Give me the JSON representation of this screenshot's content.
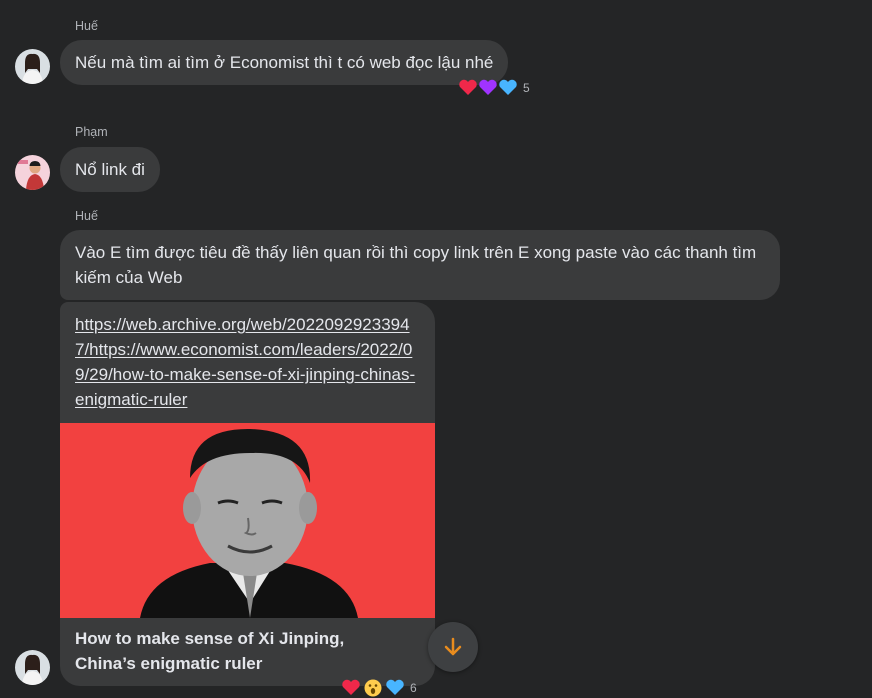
{
  "messages": [
    {
      "sender": "Huế",
      "text": "Nếu mà tìm ai tìm ở Economist thì t có web đọc lậu nhé",
      "reaction_count": "5"
    },
    {
      "sender": "Phạm",
      "text": "Nổ link đi"
    },
    {
      "sender": "Huế",
      "text": "Vào E tìm được tiêu đề thấy liên quan rồi thì copy link trên E xong paste vào các thanh tìm kiếm của Web"
    }
  ],
  "link_card": {
    "url": "https://web.archive.org/web/20220929233947/https://www.economist.com/leaders/2022/09/29/how-to-make-sense-of-xi-jinping-chinas-enigmatic-ruler",
    "title_line1": "How to make sense of Xi Jinping,",
    "title_line2": "China’s enigmatic ruler",
    "reaction_count": "6",
    "image_bg": "#f24140"
  },
  "icons": {
    "reactions_1": [
      "red-heart-icon",
      "purple-heart-icon",
      "blue-heart-icon"
    ],
    "reactions_2": [
      "red-heart-icon",
      "surprised-face-icon",
      "blue-heart-icon"
    ],
    "scroll": "arrow-down-icon"
  },
  "colors": {
    "background": "#242526",
    "bubble": "#3a3b3c",
    "scroll_arrow": "#e88c1e"
  }
}
